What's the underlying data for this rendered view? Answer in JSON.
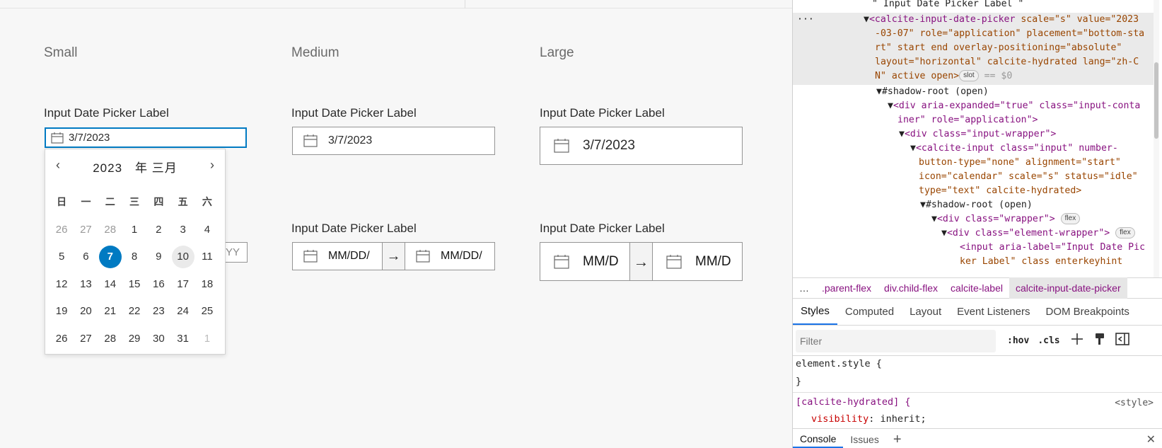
{
  "demo": {
    "columns": [
      "Small",
      "Medium",
      "Large"
    ],
    "field_label": "Input Date Picker Label",
    "date_value": "3/7/2023",
    "range_placeholder_small": "YY",
    "range_placeholder_medium": "MM/DD/",
    "range_placeholder_large": "MM/D",
    "range_arrow": "→",
    "calendar": {
      "prev": "‹",
      "next": "›",
      "month_label": "2023　年 三月",
      "weekdays": [
        "日",
        "一",
        "二",
        "三",
        "四",
        "五",
        "六"
      ],
      "days": [
        "26",
        "27",
        "28",
        "1",
        "2",
        "3",
        "4",
        "5",
        "6",
        "7",
        "8",
        "9",
        "10",
        "11",
        "12",
        "13",
        "14",
        "15",
        "16",
        "17",
        "18",
        "19",
        "20",
        "21",
        "22",
        "23",
        "24",
        "25",
        "26",
        "27",
        "28",
        "29",
        "30",
        "31",
        "1"
      ],
      "selected_day": "7",
      "current_day": "10"
    }
  },
  "devtools": {
    "top_text": "\" Input Date Picker Label \"",
    "dots": "···",
    "node_line1_tag": "<calcite-input-date-picker",
    "node_line1_rest": " scale=\"s\" value=\"2023",
    "node_line2": "-03-07\" role=\"application\" placement=\"bottom-sta",
    "node_line3": "rt\" start end overlay-positioning=\"absolute\"",
    "node_line4": "layout=\"horizontal\" calcite-hydrated lang=\"zh-C",
    "node_line5_a": "N\" active open>",
    "slot_badge": "slot",
    "node_line5_b": " == $0",
    "shadow1": "▼#shadow-root (open)",
    "div1a": "<div aria-expanded=\"true\" class=\"input-conta",
    "div1b": "iner\" role=\"application\">",
    "div2": "<div class=\"input-wrapper\">",
    "ci1": "<calcite-input class=\"input\" number-",
    "ci2": "button-type=\"none\" alignment=\"start\"",
    "ci3": "icon=\"calendar\" scale=\"s\" status=\"idle\"",
    "ci4": "type=\"text\" calcite-hydrated>",
    "shadow2": "▼#shadow-root (open)",
    "wrap": "<div class=\"wrapper\">",
    "elwrap": "<div class=\"element-wrapper\">",
    "flex_badge": "flex",
    "in1": "<input aria-label=\"Input Date Pic",
    "in2": "ker Label\" class enterkeyhint",
    "breadcrumbs": [
      ".parent-flex",
      "div.child-flex",
      "calcite-label",
      "calcite-input-date-picker"
    ],
    "breadcrumb_dots": "…",
    "tabs": [
      "Styles",
      "Computed",
      "Layout",
      "Event Listeners",
      "DOM Breakpoints"
    ],
    "filter_placeholder": "Filter",
    "hov": ":hov",
    "cls": ".cls",
    "rule1_sel": "element.style {",
    "rule1_close": "}",
    "rule2_sel": "[calcite-hydrated] {",
    "rule2_origin": "<style>",
    "rule2_prop": "visibility",
    "rule2_val": "inherit;",
    "drawer_tabs": [
      "Console",
      "Issues"
    ],
    "drawer_add": "+",
    "close": "✕"
  }
}
